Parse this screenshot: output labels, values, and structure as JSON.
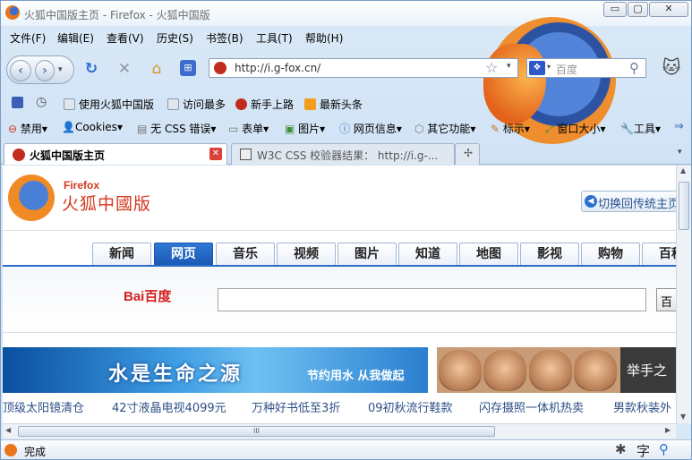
{
  "window": {
    "title": "火狐中国版主页 - Firefox - 火狐中国版",
    "minimize": "▭",
    "maximize": "▢",
    "close": "✕"
  },
  "menu": [
    "文件(F)",
    "编辑(E)",
    "查看(V)",
    "历史(S)",
    "书签(B)",
    "工具(T)",
    "帮助(H)"
  ],
  "nav": {
    "url": "http://i.g-fox.cn/",
    "search_engine_placeholder": "百度"
  },
  "bookmarks": [
    "使用火狐中国版",
    "访问最多",
    "新手上路",
    "最新头条"
  ],
  "devbar": [
    "禁用",
    "Cookies",
    "无 CSS 错误",
    "表单",
    "图片",
    "网页信息",
    "其它功能",
    "标示",
    "窗口大小",
    "工具"
  ],
  "tabs": [
    {
      "label": "火狐中国版主页",
      "active": true
    },
    {
      "label": "W3C CSS 校验器结果： http://i.g-...",
      "active": false
    }
  ],
  "page": {
    "brand_en": "Firefox",
    "brand_cn": "火狐中國版",
    "switch_label": "切换回传统主页",
    "content_tabs": [
      "新闻",
      "网页",
      "音乐",
      "视频",
      "图片",
      "知道",
      "地图",
      "影视",
      "购物",
      "百科"
    ],
    "active_tab": "网页",
    "search_logo": "Bai百度",
    "search_btn": "百",
    "banner1_text": "水是生命之源",
    "banner1_sub": "节约用水 从我做起",
    "banner2_text": "举手之",
    "ticker": [
      "顶级太阳镜清仓",
      "42寸液晶电视4099元",
      "万种好书低至3折",
      "09初秋流行鞋款",
      "闪存摄照一体机热卖",
      "男款秋装外"
    ]
  },
  "status": {
    "text": "完成",
    "hscroll_grip": "III"
  }
}
